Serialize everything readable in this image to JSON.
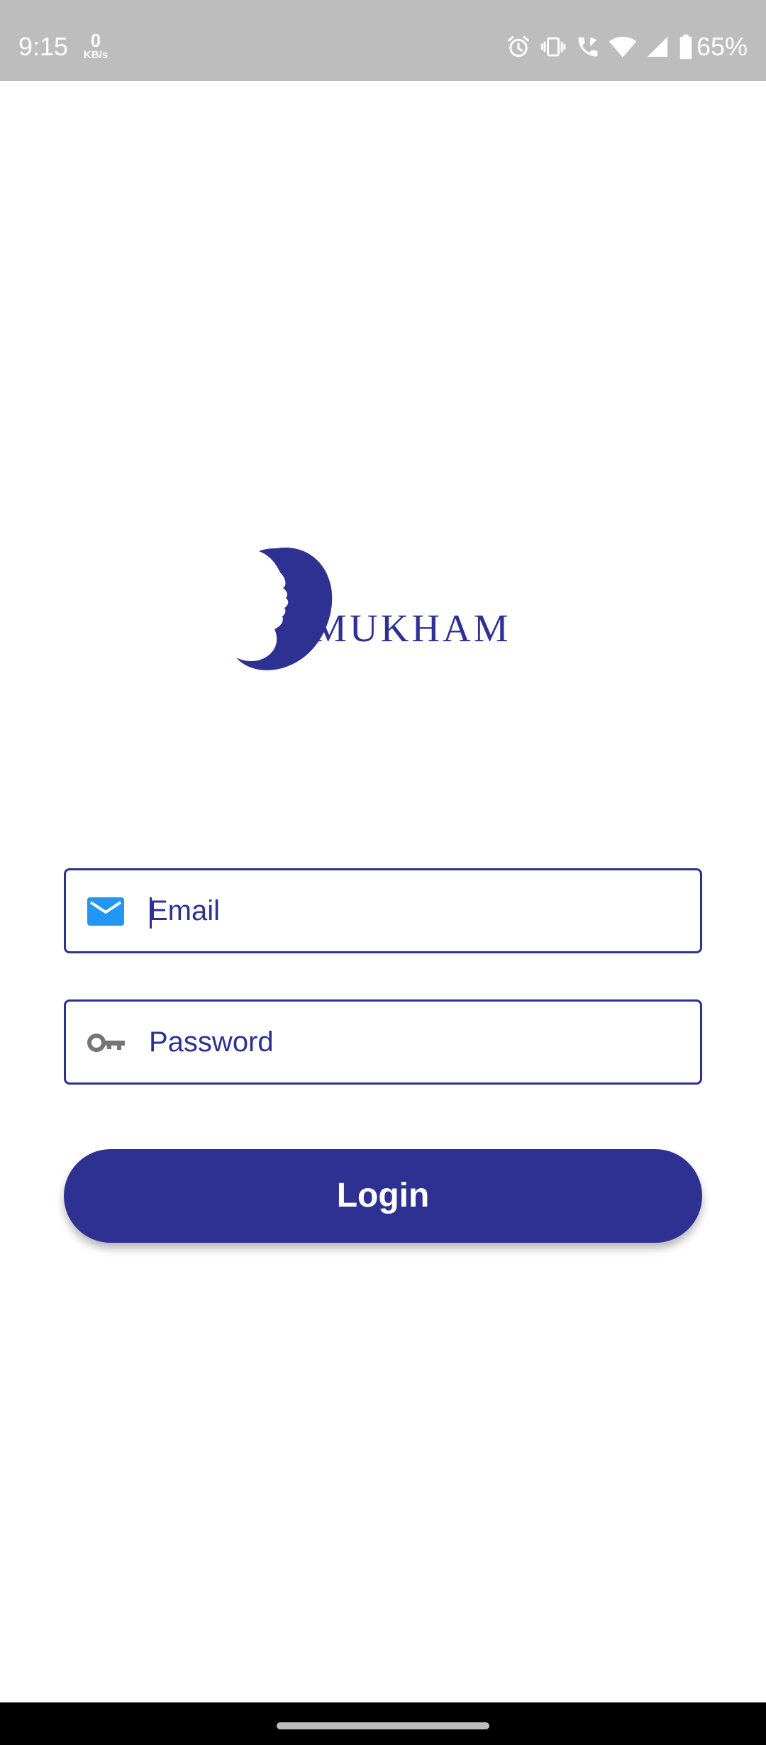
{
  "status_bar": {
    "time": "9:15",
    "speed_value": "0",
    "speed_unit": "KB/s",
    "battery_text": "65%",
    "icons": [
      "alarm-icon",
      "vibrate-icon",
      "wifi-calling-icon",
      "wifi-icon",
      "signal-icon",
      "battery-icon"
    ]
  },
  "logo": {
    "text": "MUKHAM",
    "color": "#2e3192"
  },
  "form": {
    "email": {
      "placeholder": "Email",
      "value": "",
      "icon": "email-icon",
      "icon_color": "#2196f3"
    },
    "password": {
      "placeholder": "Password",
      "value": "",
      "icon": "key-icon",
      "icon_color": "#757575"
    },
    "login_label": "Login"
  },
  "colors": {
    "accent": "#2e3192",
    "status_bar": "#bdbdbd",
    "nav_bar": "#000000"
  }
}
